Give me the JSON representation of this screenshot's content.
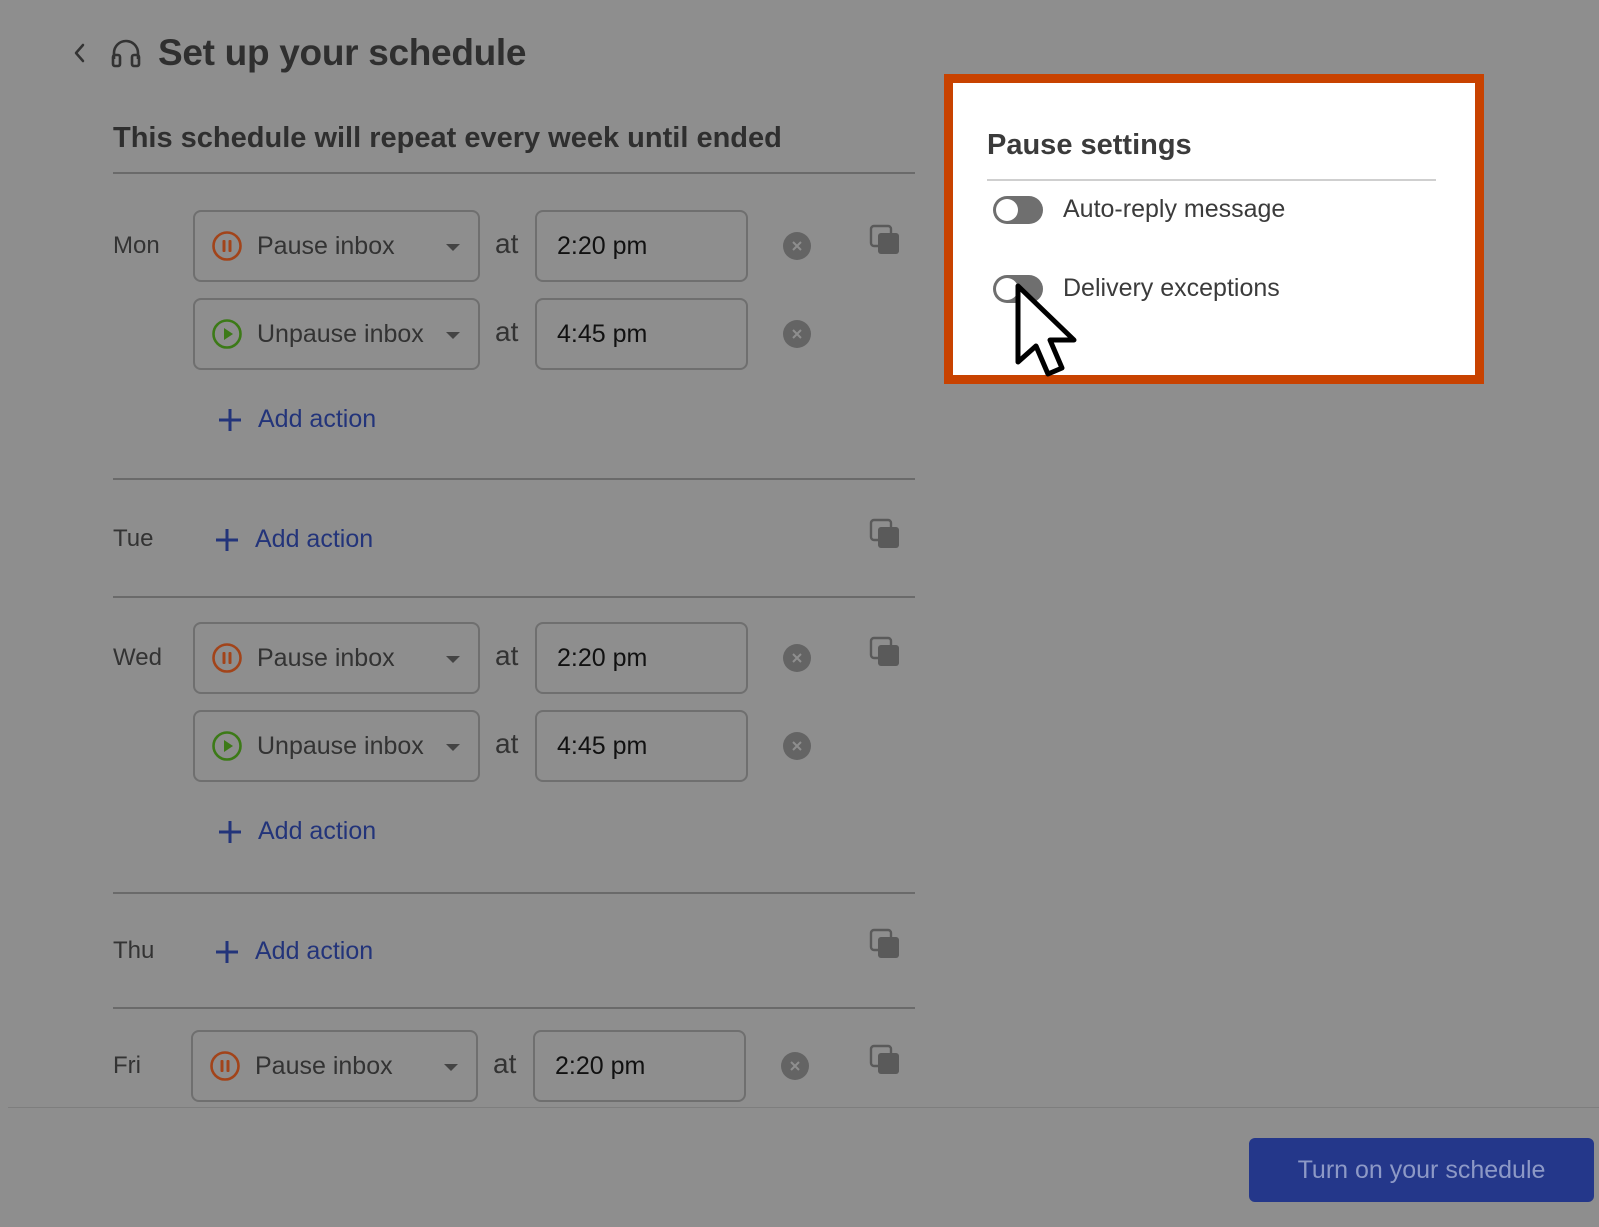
{
  "header": {
    "title": "Set up your schedule"
  },
  "schedule": {
    "subtitle": "This schedule will repeat every week until ended"
  },
  "days": {
    "mon": {
      "label": "Mon",
      "actions": [
        {
          "type": "Pause inbox",
          "at": "at",
          "time": "2:20 pm"
        },
        {
          "type": "Unpause inbox",
          "at": "at",
          "time": "4:45 pm"
        }
      ],
      "add_label": "Add action"
    },
    "tue": {
      "label": "Tue",
      "add_label": "Add action"
    },
    "wed": {
      "label": "Wed",
      "actions": [
        {
          "type": "Pause inbox",
          "at": "at",
          "time": "2:20 pm"
        },
        {
          "type": "Unpause inbox",
          "at": "at",
          "time": "4:45 pm"
        }
      ],
      "add_label": "Add action"
    },
    "thu": {
      "label": "Thu",
      "add_label": "Add action"
    },
    "fri": {
      "label": "Fri",
      "actions": [
        {
          "type": "Pause inbox",
          "at": "at",
          "time": "2:20 pm"
        }
      ]
    }
  },
  "pause_settings": {
    "title": "Pause settings",
    "toggles": [
      {
        "label": "Auto-reply message",
        "on": false
      },
      {
        "label": "Delivery exceptions",
        "on": false
      }
    ]
  },
  "footer": {
    "primary_label": "Turn on your schedule"
  },
  "colors": {
    "overlay": "#8e8e8e",
    "highlight_border": "#c84200",
    "primary": "#24378a",
    "pause_icon": "#a2441a",
    "unpause_icon": "#3c7a17",
    "link": "#23347a"
  },
  "icons": {
    "back": "chevron-left-icon",
    "headset": "headset-icon",
    "pause": "pause-circle-icon",
    "unpause": "play-circle-icon",
    "remove": "close-circle-icon",
    "copy": "copy-icon",
    "add": "plus-icon",
    "cursor": "mouse-pointer-icon"
  }
}
